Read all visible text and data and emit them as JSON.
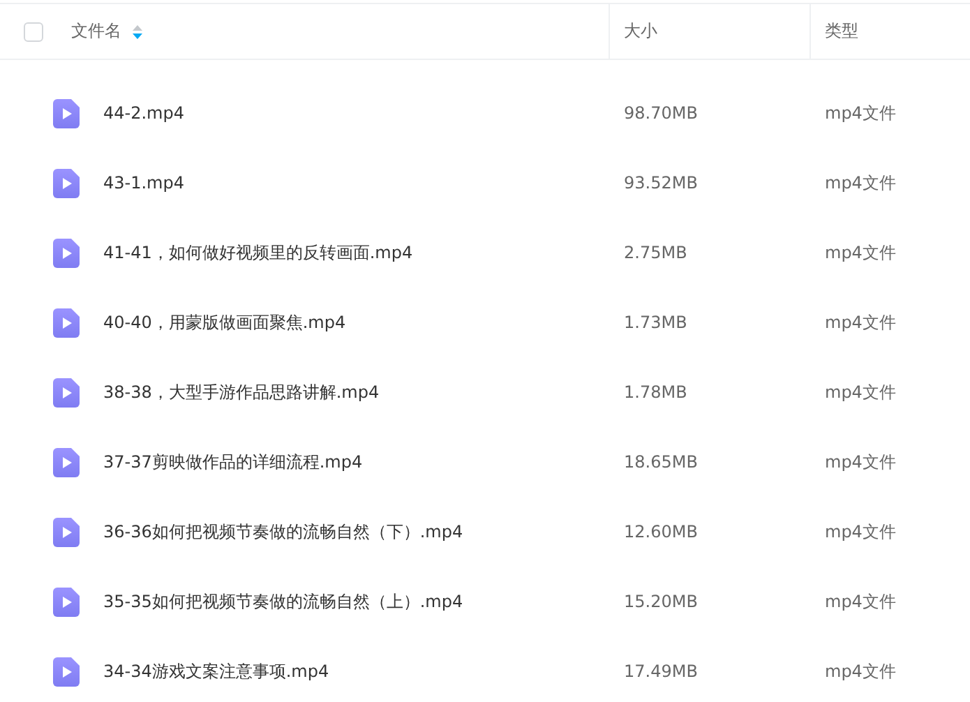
{
  "header": {
    "select_all_checked": false,
    "columns": [
      {
        "label": "文件名",
        "sorted": true
      },
      {
        "label": "大小",
        "sorted": false
      },
      {
        "label": "类型",
        "sorted": false
      }
    ]
  },
  "rows": [
    {
      "name": "44-2.mp4",
      "size": "98.70MB",
      "type": "mp4文件"
    },
    {
      "name": "43-1.mp4",
      "size": "93.52MB",
      "type": "mp4文件"
    },
    {
      "name": "41-41，如何做好视频里的反转画面.mp4",
      "size": "2.75MB",
      "type": "mp4文件"
    },
    {
      "name": "40-40，用蒙版做画面聚焦.mp4",
      "size": "1.73MB",
      "type": "mp4文件"
    },
    {
      "name": "38-38，大型手游作品思路讲解.mp4",
      "size": "1.78MB",
      "type": "mp4文件"
    },
    {
      "name": "37-37剪映做作品的详细流程.mp4",
      "size": "18.65MB",
      "type": "mp4文件"
    },
    {
      "name": "36-36如何把视频节奏做的流畅自然（下）.mp4",
      "size": "12.60MB",
      "type": "mp4文件"
    },
    {
      "name": "35-35如何把视频节奏做的流畅自然（上）.mp4",
      "size": "15.20MB",
      "type": "mp4文件"
    },
    {
      "name": "34-34游戏文案注意事项.mp4",
      "size": "17.49MB",
      "type": "mp4文件"
    }
  ]
}
